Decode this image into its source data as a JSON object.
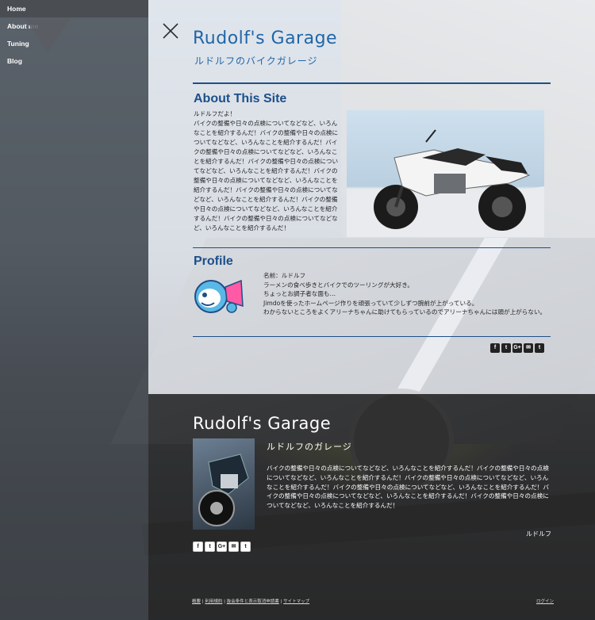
{
  "nav": {
    "items": [
      {
        "label": "Home"
      },
      {
        "label": "About me"
      },
      {
        "label": "Tuning"
      },
      {
        "label": "Blog"
      }
    ]
  },
  "header": {
    "title": "Rudolf's Garage",
    "subtitle": "ルドルフのバイクガレージ"
  },
  "about": {
    "heading": "About This Site",
    "text": "ルドルフだよ！\nバイクの整備や日々の点検についてなどなど、いろんなことを紹介するんだ！バイクの整備や日々の点検についてなどなど、いろんなことを紹介するんだ！バイクの整備や日々の点検についてなどなど、いろんなことを紹介するんだ！バイクの整備や日々の点検についてなどなど、いろんなことを紹介するんだ！バイクの整備や日々の点検についてなどなど、いろんなことを紹介するんだ！バイクの整備や日々の点検についてなどなど、いろんなことを紹介するんだ！バイクの整備や日々の点検についてなどなど、いろんなことを紹介するんだ！バイクの整備や日々の点検についてなどなど、いろんなことを紹介するんだ！"
  },
  "profile": {
    "heading": "Profile",
    "lines": [
      "名前：ルドルフ",
      "ラーメンの食べ歩きとバイクでのツーリングが大好き。",
      "ちょっとお調子者な面も…",
      "Jimdoを使ったホームページ作りを頑張っていて少しずつ腕前が上がっている。",
      "わからないところをよくアリーナちゃんに助けてもらっているのでアリーナちゃんには頭が上がらない。"
    ]
  },
  "share": {
    "buttons": [
      "f",
      "t",
      "G+",
      "✉",
      "t"
    ]
  },
  "footer": {
    "title": "Rudolf's Garage",
    "subtitle": "ルドルフのガレージ",
    "description": "バイクの整備や日々の点検についてなどなど、いろんなことを紹介するんだ！バイクの整備や日々の点検についてなどなど、いろんなことを紹介するんだ！バイクの整備や日々の点検についてなどなど、いろんなことを紹介するんだ！バイクの整備や日々の点検についてなどなど、いろんなことを紹介するんだ！バイクの整備や日々の点検についてなどなど、いろんなことを紹介するんだ！バイクの整備や日々の点検についてなどなど、いろんなことを紹介するんだ！",
    "author": "ルドルフ",
    "links": [
      "概要",
      "利用規約",
      "抜会条件と表示取消申請書",
      "サイトマップ"
    ],
    "separator": " | ",
    "login": "ログイン"
  }
}
